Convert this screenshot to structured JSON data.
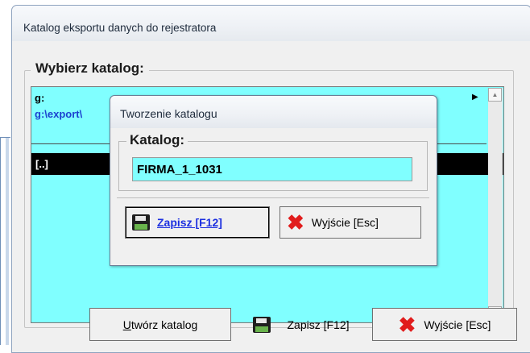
{
  "main_window": {
    "title": "Katalog eksportu danych do rejestratora",
    "group_label": "Wybierz katalog:",
    "path_drive": "g:",
    "path_dir": "g:\\export\\",
    "selected_entry": "[..]",
    "buttons": {
      "create_dir_underline": "U",
      "create_dir_rest": "twórz katalog",
      "save": "Zapisz  [F12]",
      "exit": "Wyjście  [Esc]"
    }
  },
  "dialog": {
    "title": "Tworzenie katalogu",
    "group_label": "Katalog:",
    "input_value": "FIRMA_1_1031",
    "buttons": {
      "save": "Zapisz  [F12]",
      "exit": "Wyjście  [Esc]"
    }
  },
  "icons": {
    "save": "floppy-disk-icon",
    "exit": "red-x-icon",
    "scroll_up": "scroll-up-arrow-icon",
    "scroll_down": "scroll-down-arrow-icon",
    "path_marker": "right-triangle-icon"
  },
  "colors": {
    "list_background": "#80ffff",
    "selected_row": "#000000",
    "directory_text": "#1c43d0",
    "save_label": "#1c2fe0",
    "exit_icon": "#e11c1c"
  }
}
